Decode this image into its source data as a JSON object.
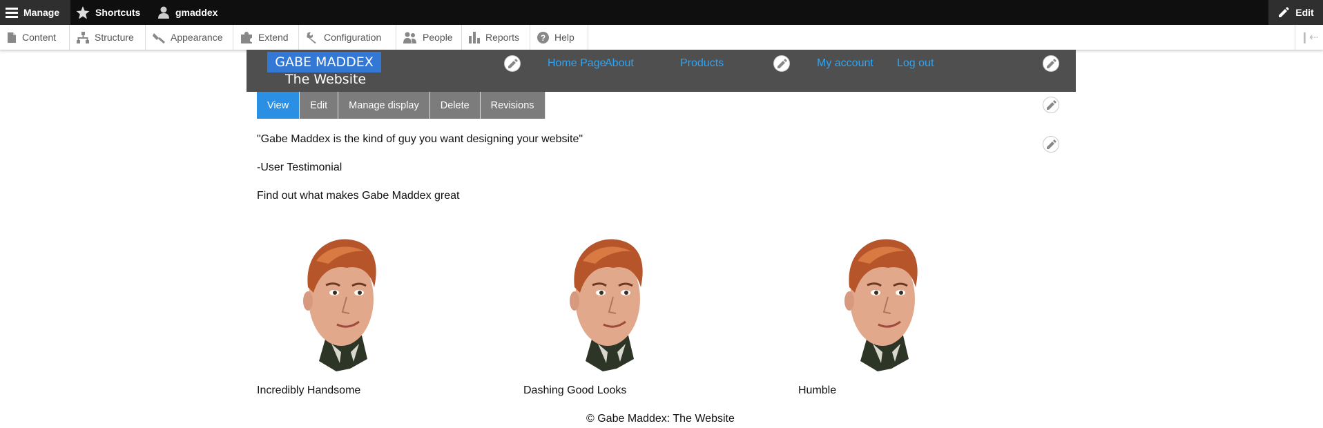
{
  "toolbar": {
    "manage": "Manage",
    "shortcuts": "Shortcuts",
    "user": "gmaddex",
    "edit": "Edit",
    "tray": [
      "Content",
      "Structure",
      "Appearance",
      "Extend",
      "Configuration",
      "People",
      "Reports",
      "Help"
    ]
  },
  "site": {
    "name": "GABE MADDEX",
    "slogan": "The Website"
  },
  "nav": {
    "main": [
      "Home Page",
      "About",
      "Products"
    ],
    "account": [
      "My account",
      "Log out"
    ]
  },
  "tabs": [
    "View",
    "Edit",
    "Manage display",
    "Delete",
    "Revisions"
  ],
  "content": {
    "quote": "\"Gabe Maddex is the kind of guy you want designing your website\"",
    "attribution": "-User Testimonial",
    "intro": "Find out what makes Gabe Maddex great",
    "features": [
      "Incredibly Handsome",
      "Dashing Good Looks",
      "Humble"
    ]
  },
  "footer": "© Gabe Maddex: The Website",
  "colors": {
    "toolbar": "#0f0f0f",
    "header": "#4f4f4f",
    "logo_bg": "#3478d6",
    "link": "#2ea4f4",
    "active_tab": "#2b8fe3",
    "tab": "#7c7c7c"
  }
}
